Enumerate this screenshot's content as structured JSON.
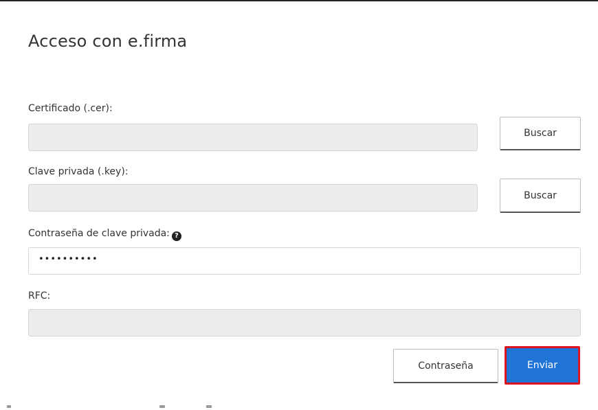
{
  "dialog": {
    "title": "Acceso con e.firma"
  },
  "fields": {
    "certificado_label": "Certificado (.cer):",
    "certificado_value": "",
    "clave_label": "Clave privada (.key):",
    "clave_value": "",
    "contrasena_label": "Contraseña de clave privada:",
    "contrasena_value": "••••••••••",
    "rfc_label": "RFC:",
    "rfc_value": ""
  },
  "buttons": {
    "buscar_cer": "Buscar",
    "buscar_key": "Buscar",
    "contrasena": "Contraseña",
    "enviar": "Enviar"
  },
  "icons": {
    "help": "question-circle-icon"
  },
  "colors": {
    "primary": "#1f74d6",
    "highlight_border": "#e0141e",
    "disabled_field": "#ececec"
  }
}
